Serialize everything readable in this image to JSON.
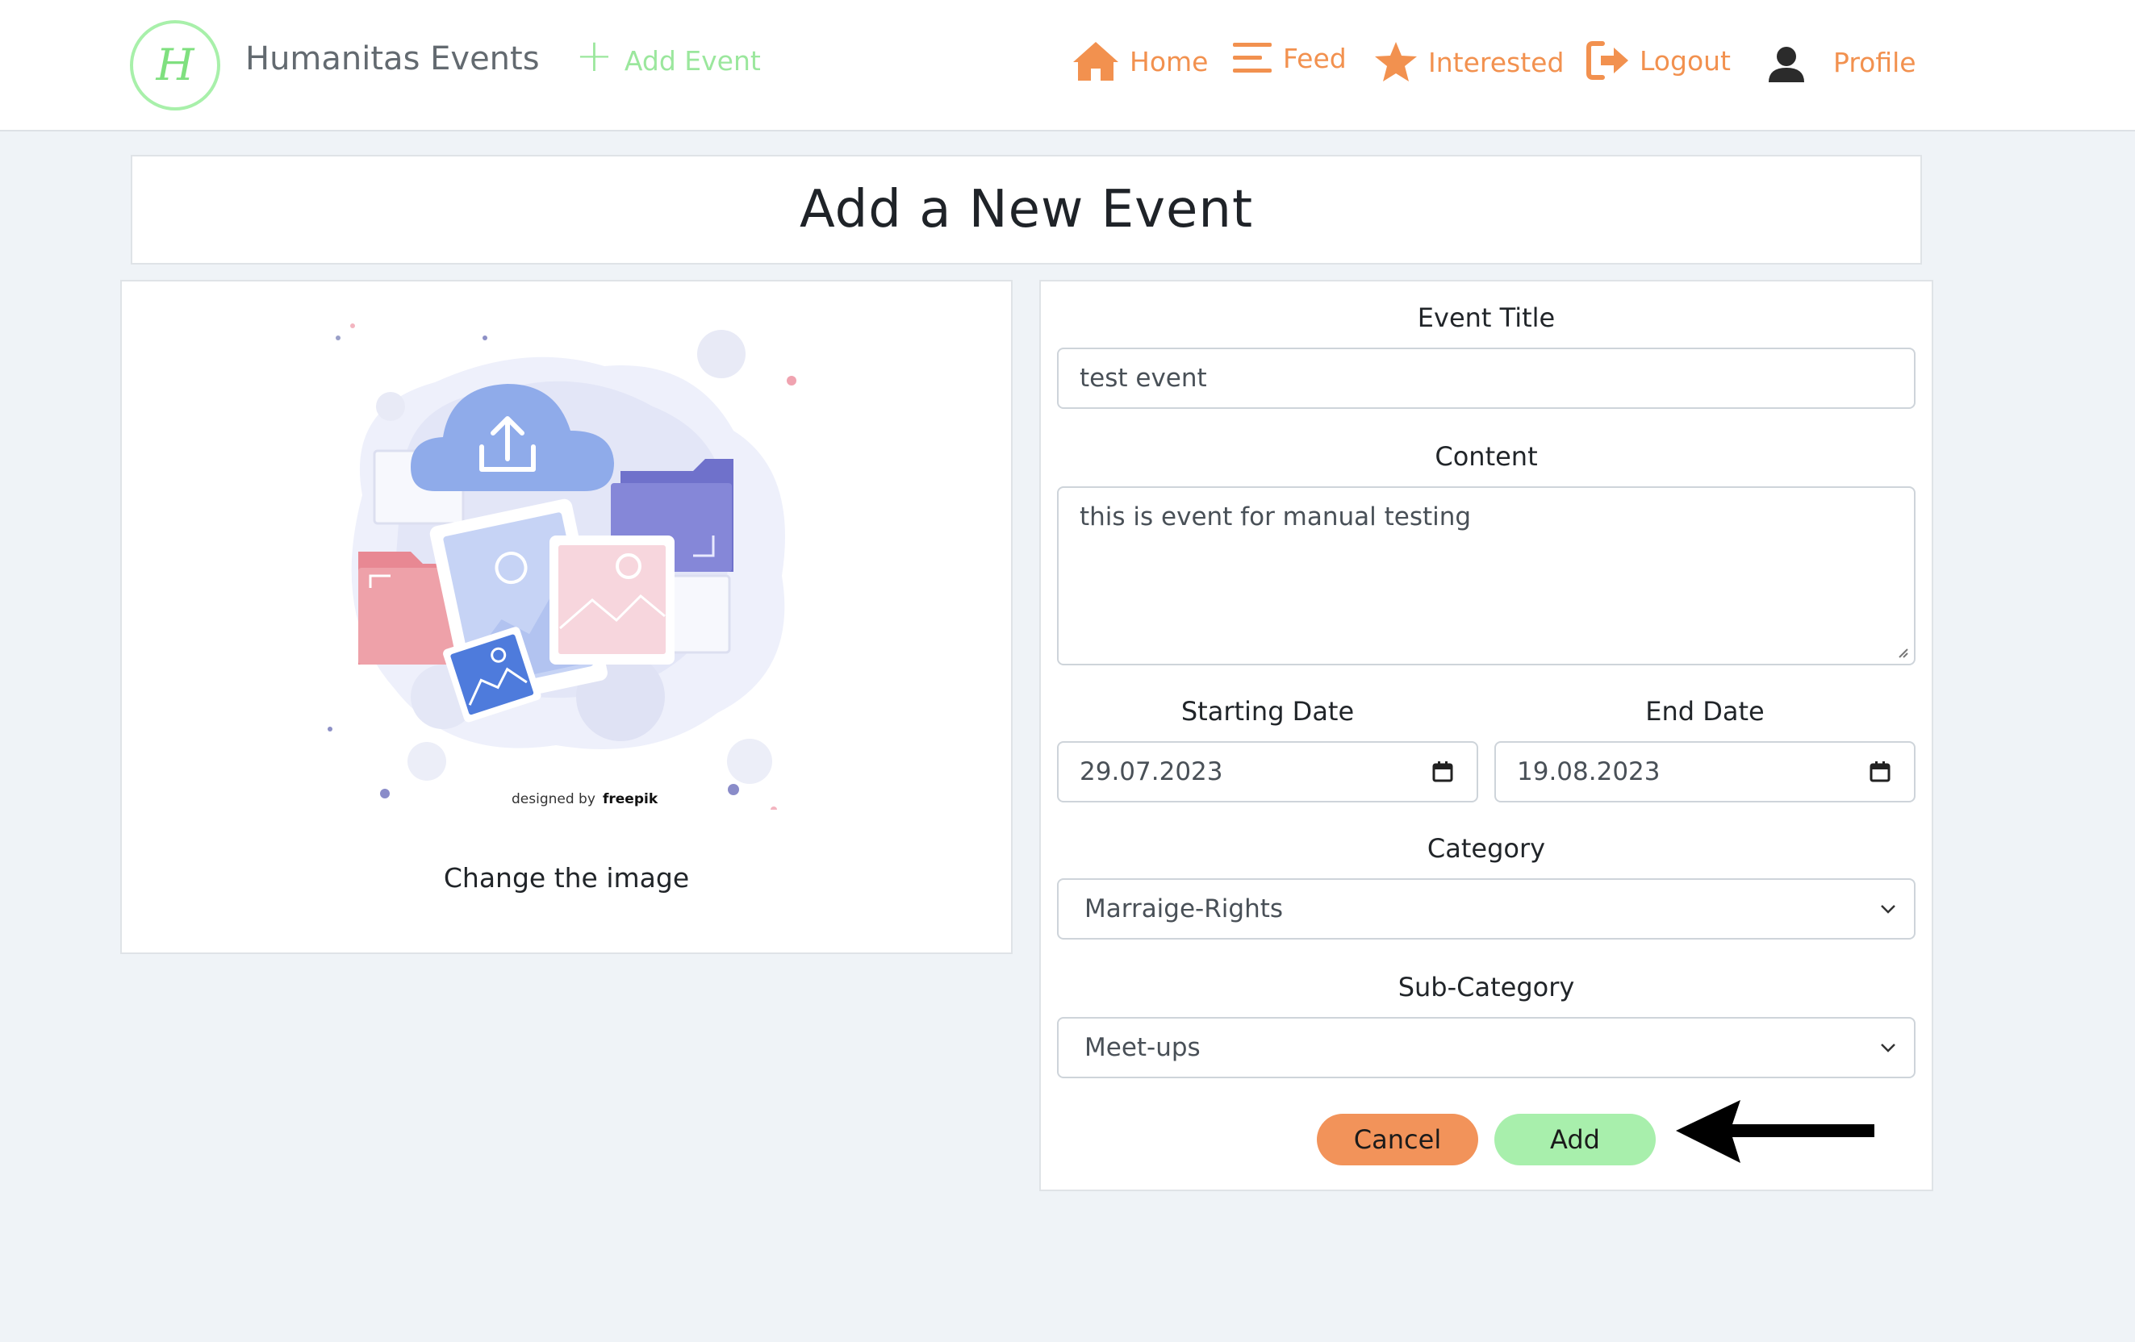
{
  "navbar": {
    "logo_letter": "H",
    "brand": "Humanitas Events",
    "add_event": "Add Event",
    "items": [
      {
        "label": "Home",
        "icon": "home-icon"
      },
      {
        "label": "Feed",
        "icon": "menu-icon"
      },
      {
        "label": "Interested",
        "icon": "star-icon"
      },
      {
        "label": "Logout",
        "icon": "logout-icon"
      }
    ],
    "profile": "Profile"
  },
  "page": {
    "title": "Add a New Event"
  },
  "image_card": {
    "credit_prefix": "designed by",
    "credit_brand": "freepik",
    "change_image": "Change the image"
  },
  "form": {
    "title_label": "Event Title",
    "title_value": "test event",
    "content_label": "Content",
    "content_value": "this is event for manual testing",
    "start_label": "Starting Date",
    "start_value": "29.07.2023",
    "end_label": "End Date",
    "end_value": "19.08.2023",
    "category_label": "Category",
    "category_value": "Marraige-Rights",
    "subcategory_label": "Sub-Category",
    "subcategory_value": "Meet-ups",
    "cancel": "Cancel",
    "add": "Add"
  },
  "colors": {
    "accent_orange": "#f2914f",
    "accent_green": "#a8efac",
    "background": "#eff3f7"
  }
}
